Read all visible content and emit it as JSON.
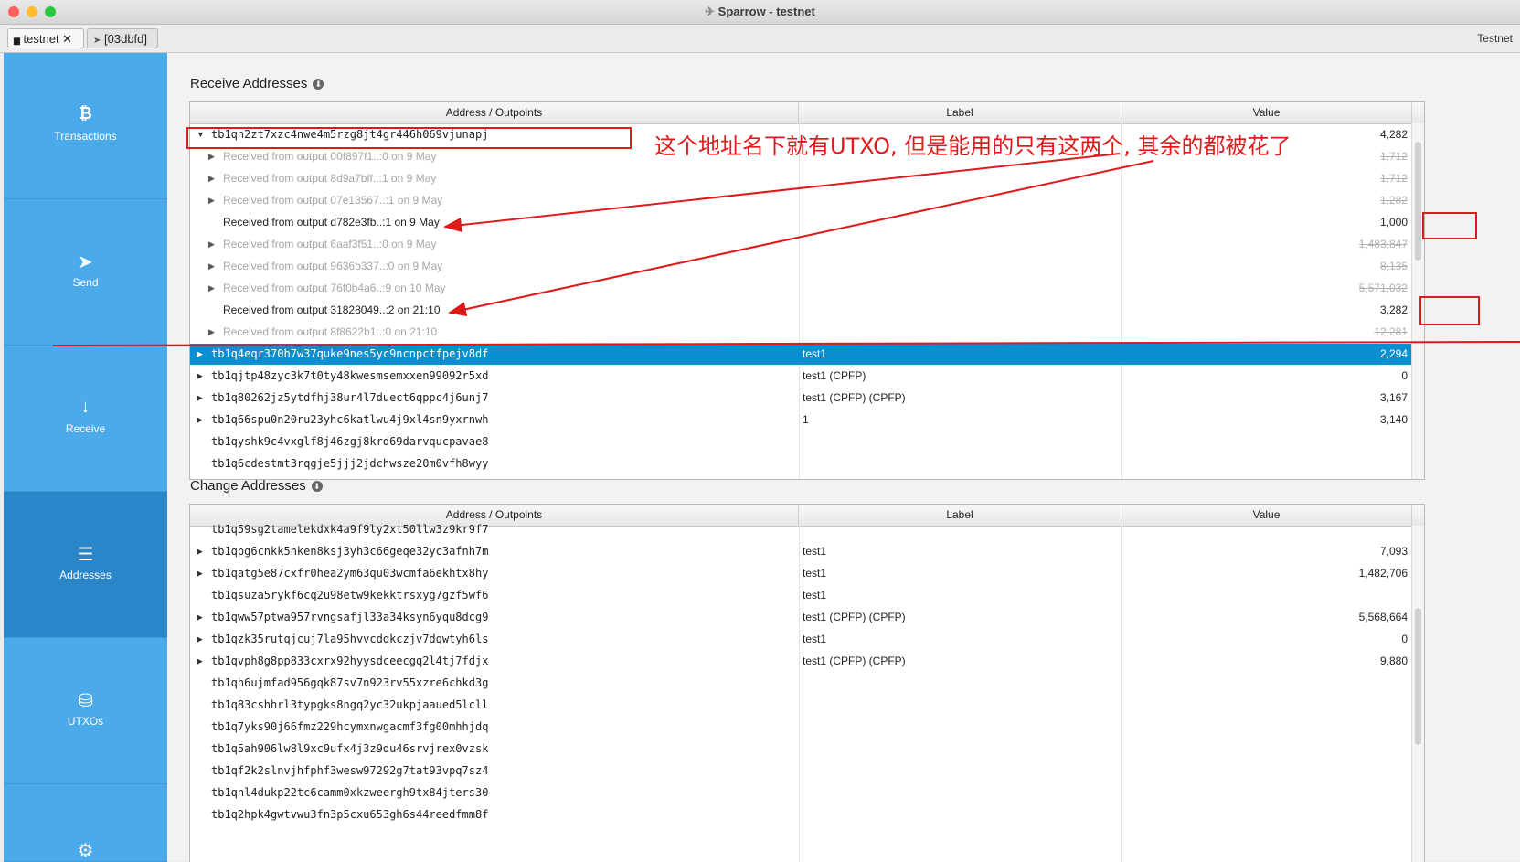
{
  "window": {
    "title": "Sparrow - testnet"
  },
  "tabs": [
    {
      "label": "testnet ✕",
      "active": true
    },
    {
      "label": "[03dbfd]",
      "active": false
    }
  ],
  "network_label": "Testnet",
  "sidebar": {
    "items": [
      {
        "label": "Transactions",
        "icon": "bitcoin-icon"
      },
      {
        "label": "Send",
        "icon": "send-icon"
      },
      {
        "label": "Receive",
        "icon": "receive-icon"
      },
      {
        "label": "Addresses",
        "icon": "list-icon",
        "active": true
      },
      {
        "label": "UTXOs",
        "icon": "coins-icon"
      },
      {
        "label": "",
        "icon": "gear-icon"
      }
    ]
  },
  "receive": {
    "title": "Receive Addresses",
    "columns": [
      "Address / Outpoints",
      "Label",
      "Value"
    ],
    "rows": [
      {
        "address": "tb1qn2zt7xzc4nwe4m5rzg8jt4gr446h069vjunapj",
        "label": "",
        "value": "4,282",
        "expanded": true
      },
      {
        "address": "Received from output 00f897f1..:0 on 9 May",
        "label": "",
        "value": "1,712",
        "child": true,
        "spent": true
      },
      {
        "address": "Received from output 8d9a7bff..:1 on 9 May",
        "label": "",
        "value": "1,712",
        "child": true,
        "spent": true
      },
      {
        "address": "Received from output 07e13567..:1 on 9 May",
        "label": "",
        "value": "1,282",
        "child": true,
        "spent": true
      },
      {
        "address": "Received from output d782e3fb..:1 on 9 May",
        "label": "",
        "value": "1,000",
        "child": true,
        "spent": false
      },
      {
        "address": "Received from output 6aaf3f51..:0 on 9 May",
        "label": "",
        "value": "1,483,847",
        "child": true,
        "spent": true
      },
      {
        "address": "Received from output 9636b337..:0 on 9 May",
        "label": "",
        "value": "8,135",
        "child": true,
        "spent": true
      },
      {
        "address": "Received from output 76f0b4a6..:9 on 10 May",
        "label": "",
        "value": "5,571,032",
        "child": true,
        "spent": true
      },
      {
        "address": "Received from output 31828049..:2 on 21:10",
        "label": "",
        "value": "3,282",
        "child": true,
        "spent": false
      },
      {
        "address": "Received from output 8f8622b1..:0 on 21:10",
        "label": "",
        "value": "12,281",
        "child": true,
        "spent": true
      },
      {
        "address": "tb1q4eqr370h7w37quke9nes5yc9ncnpctfpejv8df",
        "label": "test1",
        "value": "2,294",
        "selected": true
      },
      {
        "address": "tb1qjtp48zyc3k7t0ty48kwesmsemxxen99092r5xd",
        "label": "test1 (CPFP)",
        "value": "0"
      },
      {
        "address": "tb1q80262jz5ytdfhj38ur4l7duect6qppc4j6unj7",
        "label": "test1 (CPFP) (CPFP)",
        "value": "3,167"
      },
      {
        "address": "tb1q66spu0n20ru23yhc6katlwu4j9xl4sn9yxrnwh",
        "label": "1",
        "value": "3,140"
      },
      {
        "address": "tb1qyshk9c4vxglf8j46zgj8krd69darvqucpavae8",
        "label": "",
        "value": "",
        "leaf": true
      },
      {
        "address": "tb1q6cdestmt3rqgje5jjj2jdchwsze20m0vfh8wyy",
        "label": "",
        "value": "",
        "leaf": true
      }
    ]
  },
  "change": {
    "title": "Change Addresses",
    "columns": [
      "Address / Outpoints",
      "Label",
      "Value"
    ],
    "rows": [
      {
        "address": "tb1q59sg2tamelekdxk4a9f9ly2xt50llw3z9kr9f7",
        "label": "",
        "value": "",
        "leaf": true
      },
      {
        "address": "tb1qpg6cnkk5nken8ksj3yh3c66geqe32yc3afnh7m",
        "label": "test1",
        "value": "7,093"
      },
      {
        "address": "tb1qatg5e87cxfr0hea2ym63qu03wcmfa6ekhtx8hy",
        "label": "test1",
        "value": "1,482,706"
      },
      {
        "address": "tb1qsuza5rykf6cq2u98etw9kekktrsxyg7gzf5wf6",
        "label": "test1",
        "value": "",
        "leaf": true
      },
      {
        "address": "tb1qww57ptwa957rvngsafjl33a34ksyn6yqu8dcg9",
        "label": "test1 (CPFP) (CPFP)",
        "value": "5,568,664"
      },
      {
        "address": "tb1qzk35rutqjcuj7la95hvvcdqkczjv7dqwtyh6ls",
        "label": "test1",
        "value": "0"
      },
      {
        "address": "tb1qvph8g8pp833cxrx92hyysdceecgq2l4tj7fdjx",
        "label": "test1 (CPFP) (CPFP)",
        "value": "9,880"
      },
      {
        "address": "tb1qh6ujmfad956gqk87sv7n923rv55xzre6chkd3g",
        "label": "",
        "value": "",
        "leaf": true
      },
      {
        "address": "tb1q83cshhrl3typgks8ngq2yc32ukpjaaued5lcll",
        "label": "",
        "value": "",
        "leaf": true
      },
      {
        "address": "tb1q7yks90j66fmz229hcymxnwgacmf3fg00mhhjdq",
        "label": "",
        "value": "",
        "leaf": true
      },
      {
        "address": "tb1q5ah906lw8l9xc9ufx4j3z9du46srvjrex0vzsk",
        "label": "",
        "value": "",
        "leaf": true
      },
      {
        "address": "tb1qf2k2slnvjhfphf3wesw97292g7tat93vpq7sz4",
        "label": "",
        "value": "",
        "leaf": true
      },
      {
        "address": "tb1qnl4dukp22tc6camm0xkzweergh9tx84jters30",
        "label": "",
        "value": "",
        "leaf": true
      },
      {
        "address": "tb1q2hpk4gwtvwu3fn3p5cxu653gh6s44reedfmm8f",
        "label": "",
        "value": "",
        "leaf": true
      }
    ]
  },
  "annotation": {
    "text": "这个地址名下就有UTXO, 但是能用的只有这两个, 其余的都被花了",
    "color": "#e0191b"
  }
}
